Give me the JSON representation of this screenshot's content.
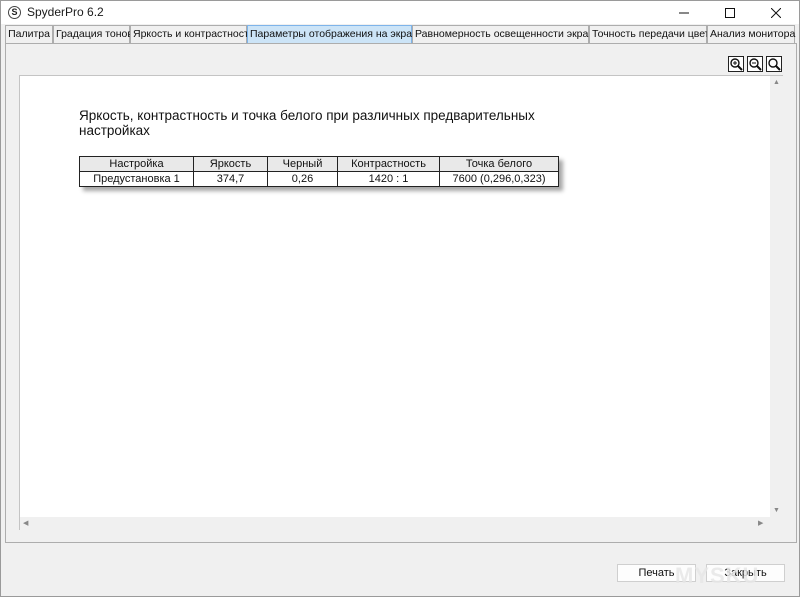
{
  "window": {
    "title": "SpyderPro 6.2",
    "icon_label": "S"
  },
  "tabs": [
    {
      "label": "Палитра",
      "active": false
    },
    {
      "label": "Градация тонов",
      "active": false
    },
    {
      "label": "Яркость и контрастность",
      "active": false
    },
    {
      "label": "Параметры отображения на экране",
      "active": true
    },
    {
      "label": "Равномерность освещенности экрана",
      "active": false
    },
    {
      "label": "Точность передачи цвета",
      "active": false
    },
    {
      "label": "Анализ монитора",
      "active": false
    }
  ],
  "toolbar": {
    "zoom_in_icon": "zoom-in-icon",
    "zoom_out_icon": "zoom-out-icon",
    "zoom_fit_icon": "zoom-fit-icon"
  },
  "report": {
    "title": "Яркость, контрастность и точка белого при различных предварительных настройках",
    "columns": [
      "Настройка",
      "Яркость",
      "Черный",
      "Контрастность",
      "Точка белого"
    ],
    "rows": [
      [
        "Предустановка 1",
        "374,7",
        "0,26",
        "1420 : 1",
        "7600 (0,296,0,323)"
      ]
    ]
  },
  "buttons": {
    "print": "Печать",
    "close": "Закрыть"
  },
  "watermark": "MYSKU",
  "colors": {
    "active_tab": "#cce4f7",
    "background": "#f0f0f0"
  }
}
